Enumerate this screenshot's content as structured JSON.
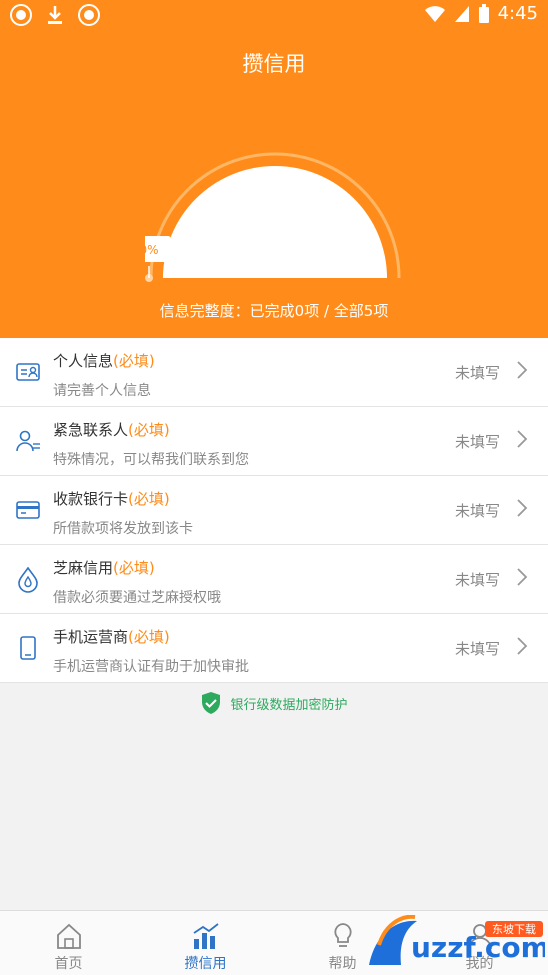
{
  "status_bar": {
    "time": "4:45"
  },
  "header": {
    "title": "攒信用",
    "gauge_percent_label": "0%",
    "progress_text": "信息完整度：已完成0项 / 全部5项",
    "completed": 0,
    "total": 5
  },
  "items": [
    {
      "title": "个人信息",
      "required": "(必填)",
      "subtitle": "请完善个人信息",
      "status": "未填写",
      "icon": "id-card-icon"
    },
    {
      "title": "紧急联系人",
      "required": "(必填)",
      "subtitle": "特殊情况，可以帮我们联系到您",
      "status": "未填写",
      "icon": "contact-person-icon"
    },
    {
      "title": "收款银行卡",
      "required": "(必填)",
      "subtitle": "所借款项将发放到该卡",
      "status": "未填写",
      "icon": "bank-card-icon"
    },
    {
      "title": "芝麻信用",
      "required": "(必填)",
      "subtitle": "借款必须要通过芝麻授权哦",
      "status": "未填写",
      "icon": "sesame-drop-icon"
    },
    {
      "title": "手机运营商",
      "required": "(必填)",
      "subtitle": "手机运营商认证有助于加快审批",
      "status": "未填写",
      "icon": "phone-icon"
    }
  ],
  "security_note": "银行级数据加密防护",
  "tabs": [
    {
      "label": "首页",
      "icon": "home-icon"
    },
    {
      "label": "攒信用",
      "icon": "bar-chart-icon",
      "active": true
    },
    {
      "label": "帮助",
      "icon": "bulb-icon"
    },
    {
      "label": "我的",
      "icon": "user-icon"
    }
  ],
  "watermark": {
    "text": "uzzf.com",
    "badge": "东坡下载"
  },
  "colors": {
    "brand": "#ff8c1a",
    "accent_blue": "#2f74c6",
    "secure_green": "#2eaa5f"
  }
}
